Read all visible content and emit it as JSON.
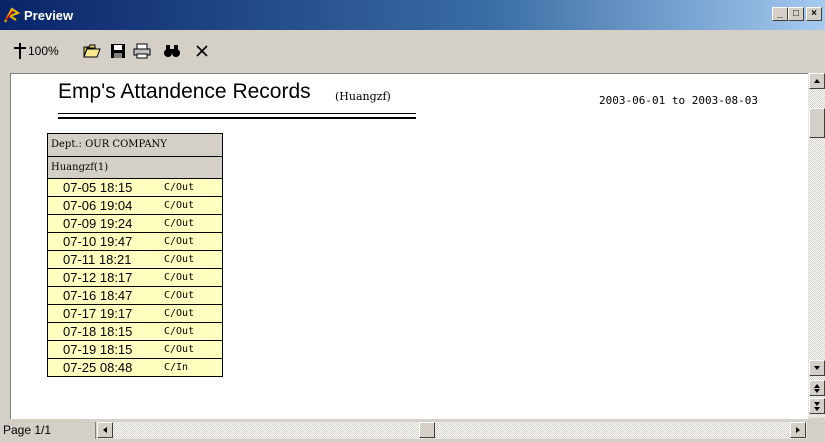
{
  "window": {
    "title": "Preview",
    "controls": {
      "minimize": "_",
      "maximize": "□",
      "close": "×"
    }
  },
  "toolbar": {
    "zoom_label": "100%",
    "icons": [
      "zoom-icon",
      "open-folder-icon",
      "save-icon",
      "print-icon",
      "find-icon",
      "close-icon"
    ]
  },
  "report": {
    "title": "Emp's Attandence Records",
    "owner": "(Huangzf)",
    "date_range": "2003-06-01 to 2003-08-03",
    "dept_label": "Dept.: OUR COMPANY",
    "employee_label": "Huangzf(1)",
    "records": [
      {
        "time": "07-05 18:15",
        "status": "C/Out"
      },
      {
        "time": "07-06 19:04",
        "status": "C/Out"
      },
      {
        "time": "07-09 19:24",
        "status": "C/Out"
      },
      {
        "time": "07-10 19:47",
        "status": "C/Out"
      },
      {
        "time": "07-11 18:21",
        "status": "C/Out"
      },
      {
        "time": "07-12 18:17",
        "status": "C/Out"
      },
      {
        "time": "07-16 18:47",
        "status": "C/Out"
      },
      {
        "time": "07-17 19:17",
        "status": "C/Out"
      },
      {
        "time": "07-18 18:15",
        "status": "C/Out"
      },
      {
        "time": "07-19 18:15",
        "status": "C/Out"
      },
      {
        "time": "07-25 08:48",
        "status": "C/In"
      }
    ]
  },
  "statusbar": {
    "page_label": "Page 1/1"
  },
  "colors": {
    "title_bar": "#0a246a",
    "row_fill": "#ffffc0",
    "window_face": "#d4d0c8"
  }
}
